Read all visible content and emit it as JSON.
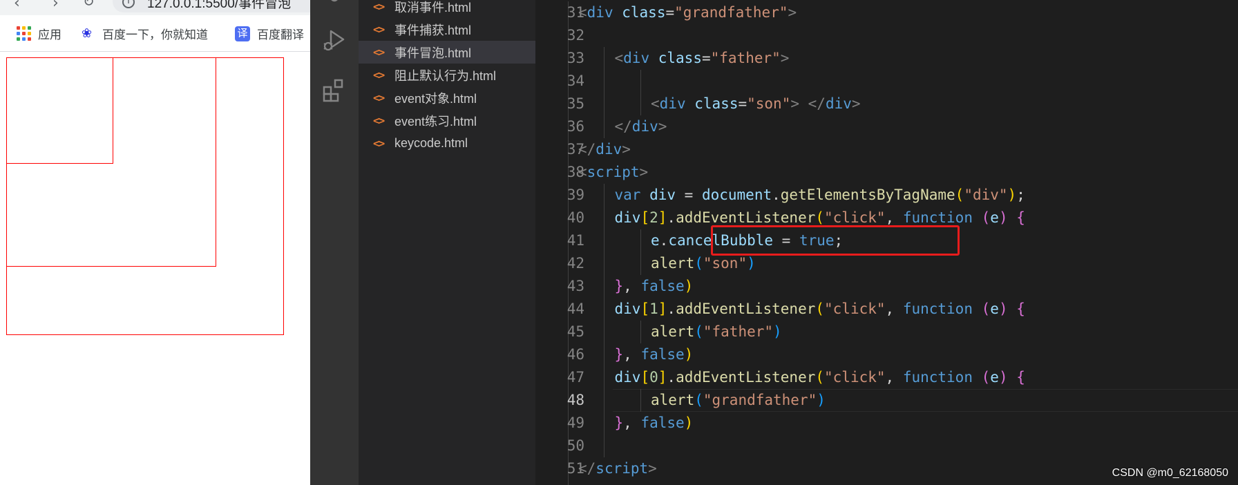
{
  "browser": {
    "url_text": "127.0.0.1:5500/事件冒泡",
    "bookmarks": [
      {
        "label": "应用",
        "icon": "apps-grid-icon"
      },
      {
        "label": "百度一下，你就知道",
        "icon": "baidu-paw-icon"
      },
      {
        "label": "百度翻译",
        "icon": "translate-icon"
      }
    ],
    "translate_glyph": "译"
  },
  "explorer": {
    "files": [
      {
        "name": "取消事件.html",
        "active": false
      },
      {
        "name": "事件捕获.html",
        "active": false
      },
      {
        "name": "事件冒泡.html",
        "active": true
      },
      {
        "name": "阻止默认行为.html",
        "active": false
      },
      {
        "name": "event对象.html",
        "active": false
      },
      {
        "name": "event练习.html",
        "active": false
      },
      {
        "name": "keycode.html",
        "active": false
      }
    ],
    "file_icon_glyph": "<>"
  },
  "editor": {
    "current_line": 48,
    "lines": [
      {
        "n": "31",
        "tokens": [
          [
            "<",
            "t-tag"
          ],
          [
            "div",
            "t-name"
          ],
          [
            " ",
            ""
          ],
          [
            "class",
            "t-attr"
          ],
          [
            "=",
            "t-op"
          ],
          [
            "\"grandfather\"",
            "t-str"
          ],
          [
            ">",
            "t-tag"
          ]
        ],
        "indent": 1
      },
      {
        "n": "32",
        "tokens": [],
        "indent": 0
      },
      {
        "n": "33",
        "tokens": [
          [
            "<",
            "t-tag"
          ],
          [
            "div",
            "t-name"
          ],
          [
            " ",
            ""
          ],
          [
            "class",
            "t-attr"
          ],
          [
            "=",
            "t-op"
          ],
          [
            "\"father\"",
            "t-str"
          ],
          [
            ">",
            "t-tag"
          ]
        ],
        "indent": 2
      },
      {
        "n": "34",
        "tokens": [],
        "indent": 0
      },
      {
        "n": "35",
        "tokens": [
          [
            "<",
            "t-tag"
          ],
          [
            "div",
            "t-name"
          ],
          [
            " ",
            ""
          ],
          [
            "class",
            "t-attr"
          ],
          [
            "=",
            "t-op"
          ],
          [
            "\"son\"",
            "t-str"
          ],
          [
            ">",
            "t-tag"
          ],
          [
            " ",
            ""
          ],
          [
            "</",
            "t-tag"
          ],
          [
            "div",
            "t-name"
          ],
          [
            ">",
            "t-tag"
          ]
        ],
        "indent": 3
      },
      {
        "n": "36",
        "tokens": [
          [
            "</",
            "t-tag"
          ],
          [
            "div",
            "t-name"
          ],
          [
            ">",
            "t-tag"
          ]
        ],
        "indent": 2
      },
      {
        "n": "37",
        "tokens": [
          [
            "</",
            "t-tag"
          ],
          [
            "div",
            "t-name"
          ],
          [
            ">",
            "t-tag"
          ]
        ],
        "indent": 1
      },
      {
        "n": "38",
        "tokens": [
          [
            "<",
            "t-tag"
          ],
          [
            "script",
            "t-name"
          ],
          [
            ">",
            "t-tag"
          ]
        ],
        "indent": 1
      },
      {
        "n": "39",
        "tokens": [
          [
            "var",
            "t-kw"
          ],
          [
            " ",
            ""
          ],
          [
            "div",
            "t-var"
          ],
          [
            " = ",
            "t-op"
          ],
          [
            "document",
            "t-var"
          ],
          [
            ".",
            "t-op"
          ],
          [
            "getElementsByTagName",
            "t-fn"
          ],
          [
            "(",
            "t-p1"
          ],
          [
            "\"div\"",
            "t-str"
          ],
          [
            ")",
            "t-p1"
          ],
          [
            ";",
            "t-op"
          ]
        ],
        "indent": 2
      },
      {
        "n": "40",
        "tokens": [
          [
            "div",
            "t-var"
          ],
          [
            "[",
            "t-p1"
          ],
          [
            "2",
            "t-num"
          ],
          [
            "]",
            "t-p1"
          ],
          [
            ".",
            "t-op"
          ],
          [
            "addEventListener",
            "t-fn"
          ],
          [
            "(",
            "t-p1"
          ],
          [
            "\"click\"",
            "t-str"
          ],
          [
            ", ",
            "t-op"
          ],
          [
            "function",
            "t-kw"
          ],
          [
            " ",
            ""
          ],
          [
            "(",
            "t-p2"
          ],
          [
            "e",
            "t-var"
          ],
          [
            ")",
            "t-p2"
          ],
          [
            " ",
            ""
          ],
          [
            "{",
            "t-p2"
          ]
        ],
        "indent": 2
      },
      {
        "n": "41",
        "tokens": [
          [
            "e",
            "t-var"
          ],
          [
            ".",
            "t-op"
          ],
          [
            "cancelBubble",
            "t-var"
          ],
          [
            " = ",
            "t-op"
          ],
          [
            "true",
            "t-bool"
          ],
          [
            ";",
            "t-op"
          ]
        ],
        "indent": 3
      },
      {
        "n": "42",
        "tokens": [
          [
            "alert",
            "t-fn"
          ],
          [
            "(",
            "t-p3"
          ],
          [
            "\"son\"",
            "t-str"
          ],
          [
            ")",
            "t-p3"
          ]
        ],
        "indent": 3
      },
      {
        "n": "43",
        "tokens": [
          [
            "}",
            "t-p2"
          ],
          [
            ", ",
            "t-op"
          ],
          [
            "false",
            "t-bool"
          ],
          [
            ")",
            "t-p1"
          ]
        ],
        "indent": 2
      },
      {
        "n": "44",
        "tokens": [
          [
            "div",
            "t-var"
          ],
          [
            "[",
            "t-p1"
          ],
          [
            "1",
            "t-num"
          ],
          [
            "]",
            "t-p1"
          ],
          [
            ".",
            "t-op"
          ],
          [
            "addEventListener",
            "t-fn"
          ],
          [
            "(",
            "t-p1"
          ],
          [
            "\"click\"",
            "t-str"
          ],
          [
            ", ",
            "t-op"
          ],
          [
            "function",
            "t-kw"
          ],
          [
            " ",
            ""
          ],
          [
            "(",
            "t-p2"
          ],
          [
            "e",
            "t-var"
          ],
          [
            ")",
            "t-p2"
          ],
          [
            " ",
            ""
          ],
          [
            "{",
            "t-p2"
          ]
        ],
        "indent": 2
      },
      {
        "n": "45",
        "tokens": [
          [
            "alert",
            "t-fn"
          ],
          [
            "(",
            "t-p3"
          ],
          [
            "\"father\"",
            "t-str"
          ],
          [
            ")",
            "t-p3"
          ]
        ],
        "indent": 3
      },
      {
        "n": "46",
        "tokens": [
          [
            "}",
            "t-p2"
          ],
          [
            ", ",
            "t-op"
          ],
          [
            "false",
            "t-bool"
          ],
          [
            ")",
            "t-p1"
          ]
        ],
        "indent": 2
      },
      {
        "n": "47",
        "tokens": [
          [
            "div",
            "t-var"
          ],
          [
            "[",
            "t-p1"
          ],
          [
            "0",
            "t-num"
          ],
          [
            "]",
            "t-p1"
          ],
          [
            ".",
            "t-op"
          ],
          [
            "addEventListener",
            "t-fn"
          ],
          [
            "(",
            "t-p1"
          ],
          [
            "\"click\"",
            "t-str"
          ],
          [
            ", ",
            "t-op"
          ],
          [
            "function",
            "t-kw"
          ],
          [
            " ",
            ""
          ],
          [
            "(",
            "t-p2"
          ],
          [
            "e",
            "t-var"
          ],
          [
            ")",
            "t-p2"
          ],
          [
            " ",
            ""
          ],
          [
            "{",
            "t-p2"
          ]
        ],
        "indent": 2
      },
      {
        "n": "48",
        "tokens": [
          [
            "alert",
            "t-fn"
          ],
          [
            "(",
            "t-p3"
          ],
          [
            "\"grandfather\"",
            "t-str"
          ],
          [
            ")",
            "t-p3"
          ]
        ],
        "indent": 3
      },
      {
        "n": "49",
        "tokens": [
          [
            "}",
            "t-p2"
          ],
          [
            ", ",
            "t-op"
          ],
          [
            "false",
            "t-bool"
          ],
          [
            ")",
            "t-p1"
          ]
        ],
        "indent": 2
      },
      {
        "n": "50",
        "tokens": [],
        "indent": 0
      },
      {
        "n": "51",
        "tokens": [
          [
            "</",
            "t-tag"
          ],
          [
            "script",
            "t-name"
          ],
          [
            ">",
            "t-tag"
          ]
        ],
        "indent": 1
      }
    ]
  },
  "watermark": "CSDN @m0_62168050",
  "colors": {
    "highlight": "#e81c1c",
    "demo_box_border": "#ff0000",
    "editor_bg": "#1e1e1e",
    "explorer_bg": "#252526",
    "activity_bg": "#333333"
  }
}
